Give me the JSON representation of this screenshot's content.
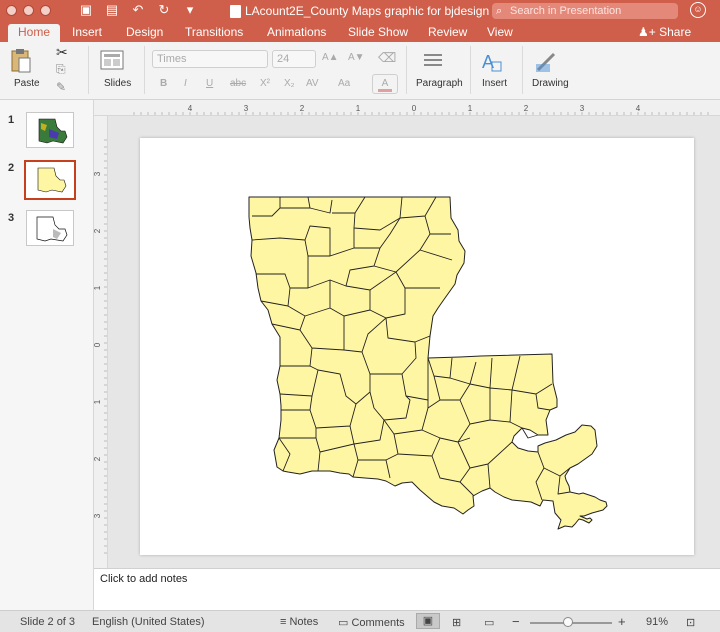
{
  "window": {
    "title": "LAcount2E_County Maps graphic for bjdesign",
    "search_placeholder": "Search in Presentation"
  },
  "tabs": [
    {
      "label": "Home",
      "active": true
    },
    {
      "label": "Insert"
    },
    {
      "label": "Design"
    },
    {
      "label": "Transitions"
    },
    {
      "label": "Animations"
    },
    {
      "label": "Slide Show"
    },
    {
      "label": "Review"
    },
    {
      "label": "View"
    }
  ],
  "share_label": "Share",
  "ribbon": {
    "paste": "Paste",
    "slides": "Slides",
    "font_name": "Times",
    "font_size": "24",
    "paragraph": "Paragraph",
    "insert": "Insert",
    "drawing": "Drawing"
  },
  "thumbnails": [
    {
      "number": "1"
    },
    {
      "number": "2",
      "selected": true
    },
    {
      "number": "3"
    }
  ],
  "ruler": {
    "h_labels": [
      "4",
      "3",
      "2",
      "1",
      "0",
      "1",
      "2",
      "3",
      "4"
    ],
    "v_labels": [
      "3",
      "2",
      "1",
      "0",
      "1",
      "2",
      "3"
    ]
  },
  "notes_placeholder": "Click to add notes",
  "status": {
    "slide_info": "Slide 2 of 3",
    "language": "English (United States)",
    "notes": "Notes",
    "comments": "Comments",
    "zoom": "91%",
    "zoom_fraction": 0.91
  },
  "colors": {
    "accent": "#cf5f4a",
    "map_fill": "#fff6a3",
    "map_stroke": "#222222"
  }
}
